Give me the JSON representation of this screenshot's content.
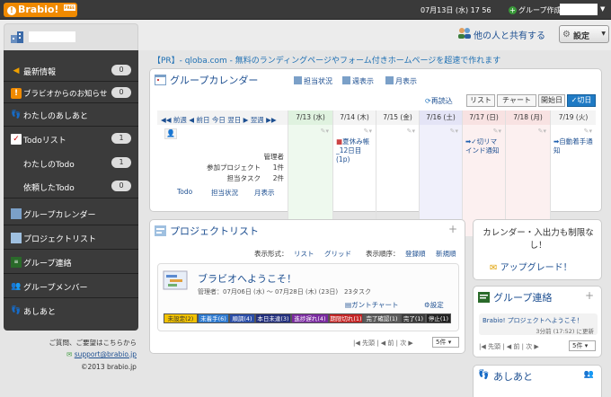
{
  "topbar": {
    "logo": "Brabio!",
    "logo_badge": "FREE",
    "date": "07月13日 (水) 17 56",
    "group_create": "グループ作成"
  },
  "header": {
    "share": "他の人と共有する",
    "settings": "設定"
  },
  "sidebar": {
    "items": [
      {
        "label": "最新情報",
        "count": "0"
      },
      {
        "label": "ブラビオからのお知らせ",
        "count": "0"
      },
      {
        "label": "わたしのあしあと",
        "count": ""
      },
      {
        "label": "Todoリスト",
        "count": "1"
      },
      {
        "label": "わたしのTodo",
        "count": "1"
      },
      {
        "label": "依頼したTodo",
        "count": "0"
      },
      {
        "label": "グループカレンダー",
        "count": ""
      },
      {
        "label": "プロジェクトリスト",
        "count": ""
      },
      {
        "label": "グループ連絡",
        "count": ""
      },
      {
        "label": "グループメンバー",
        "count": ""
      },
      {
        "label": "あしあと",
        "count": ""
      }
    ],
    "support_text": "ご質問、ご要望はこちらから",
    "support_email": "support@brabio.jp",
    "copyright": "©2013 brabio.jp"
  },
  "ad": "【PR】- qloba.com - 無料のランディングページやフォーム付きホームページを超速で作れます",
  "calendar": {
    "title": "グループカレンダー",
    "links": [
      "担当状況",
      "週表示",
      "月表示"
    ],
    "reload": "再読込",
    "views": [
      "リスト",
      "チャート",
      "開始日",
      "✓切日"
    ],
    "nav": "◀◀ 前週 ◀ 前日 今日 翌日 ▶ 翌週 ▶▶",
    "days": [
      "7/13 (水)",
      "7/14 (木)",
      "7/15 (金)",
      "7/16 (土)",
      "7/17 (日)",
      "7/18 (月)",
      "7/19 (火)"
    ],
    "manager_label": "管理者",
    "participants": "参加プロジェクト",
    "participants_count": "1件",
    "tasks": "担当タスク",
    "tasks_count": "2件",
    "footer_links": [
      "Todo",
      "担当状況",
      "月表示"
    ],
    "events": [
      {
        "day": 1,
        "text": "夏休み帳_12日目(1p)"
      },
      {
        "day": 4,
        "text": "✓切リマインド通知"
      },
      {
        "day": 6,
        "text": "自動着手通知"
      }
    ]
  },
  "projects": {
    "title": "プロジェクトリスト",
    "display_label": "表示形式：",
    "display_list": "リスト",
    "display_grid": "グリッド",
    "order_label": "表示順序：",
    "order_reg": "登録順",
    "order_new": "新規順",
    "card_title": "ブラビオへようこそ！",
    "card_meta": "管理者：07月06日 (水) 〜 07月28日 (木) (23日)　23タスク",
    "gantt": "ガントチャート",
    "card_settings": "設定",
    "statuses": [
      {
        "label": "未設定(2)",
        "color": "#f2c200"
      },
      {
        "label": "未着手(6)",
        "color": "#2f7bd0"
      },
      {
        "label": "順調(4)",
        "color": "#2b4ea8"
      },
      {
        "label": "本日未達(3)",
        "color": "#23307d"
      },
      {
        "label": "進捗遅れ(4)",
        "color": "#7a2aa0"
      },
      {
        "label": "期限切れ(1)",
        "color": "#c42424"
      },
      {
        "label": "完了確認(1)",
        "color": "#5a5a5a"
      },
      {
        "label": "完了(1)",
        "color": "#3c3c3c"
      },
      {
        "label": "停止(1)",
        "color": "#222222"
      }
    ],
    "pager": "|◀ 先頭 | ◀ 前 | 次 ▶",
    "per_page": "5件"
  },
  "promo": {
    "text": "カレンダー・入出力も制限なし！",
    "upgrade": "アップグレード！"
  },
  "group_contact": {
    "title": "グループ連絡",
    "message": "Brabio! プロジェクトへようこそ！",
    "time": "3分前 (17:52) に更新",
    "pager": "|◀ 先頭 | ◀ 前 | 次 ▶",
    "per_page": "5件"
  },
  "footprints": {
    "title": "あしあと"
  }
}
